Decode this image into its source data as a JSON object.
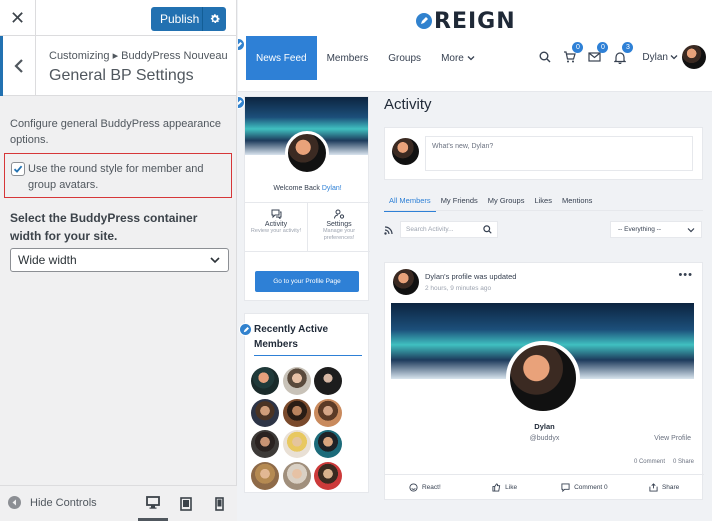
{
  "customizer": {
    "close_label": "✕",
    "publish_label": "Publish",
    "breadcrumb_root": "Customizing",
    "breadcrumb_section": "BuddyPress Nouveau",
    "title": "General BP Settings",
    "description": "Configure general BuddyPress appearance options.",
    "round_style_label": "Use the round style for member and group avatars.",
    "round_style_checked": true,
    "container_width_label": "Select the BuddyPress container width for your site.",
    "container_width_value": "Wide width",
    "hide_controls_label": "Hide Controls",
    "devices": [
      "desktop",
      "tablet",
      "mobile"
    ],
    "active_device": "desktop"
  },
  "site": {
    "logo_text": "REIGN",
    "nav": [
      {
        "label": "News Feed",
        "active": true
      },
      {
        "label": "Members",
        "active": false
      },
      {
        "label": "Groups",
        "active": false
      },
      {
        "label": "More",
        "active": false
      }
    ],
    "cart_count": "0",
    "messages_count": "0",
    "notifications_count": "3",
    "user_name": "Dylan",
    "accent_color": "#2e80d6"
  },
  "profile_card": {
    "welcome_prefix": "Welcome Back",
    "welcome_name": "Dylan!",
    "links": [
      {
        "label": "Activity",
        "sub": "Review your activity!"
      },
      {
        "label": "Settings",
        "sub": "Manage your preferences!"
      }
    ],
    "button_label": "Go to your Profile Page"
  },
  "recent_members": {
    "title": "Recently Active Members",
    "count": 12
  },
  "activity": {
    "title": "Activity",
    "post_placeholder": "What's new, Dylan?",
    "tabs": [
      "All Members",
      "My Friends",
      "My Groups",
      "Likes",
      "Mentions"
    ],
    "active_tab": "All Members",
    "search_placeholder": "Search Activity...",
    "filter_value": "-- Everything --",
    "update": {
      "title": "Dylan's profile was updated",
      "time": "2 hours, 9 minutes ago",
      "name": "Dylan",
      "handle": "@buddyx",
      "view_profile": "View Profile",
      "comment_count": "0 Comment",
      "share_count": "0 Share",
      "actions": [
        "React!",
        "Like",
        "Comment 0",
        "Share"
      ]
    }
  }
}
